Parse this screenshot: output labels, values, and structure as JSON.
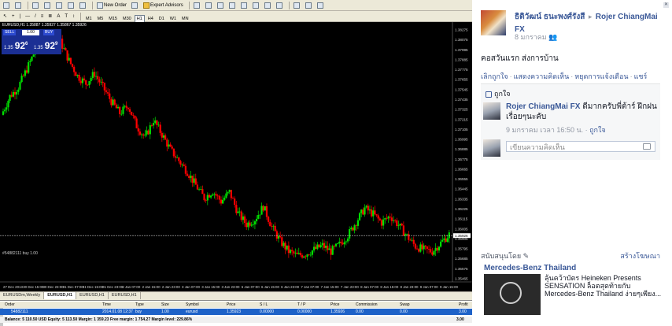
{
  "toolbar": {
    "new_order": "New Order",
    "expert_advisors": "Expert Advisors",
    "timeframes": [
      "M1",
      "M5",
      "M15",
      "M30",
      "H1",
      "H4",
      "D1",
      "W1",
      "MN"
    ],
    "active_timeframe": "H1"
  },
  "chart": {
    "title": "EURUSD,H1  1.35887 1.35927 1.35867 1.35926",
    "order_line_label": "#54882111 buy 1.00"
  },
  "trade_panel": {
    "sell_label": "SELL",
    "buy_label": "BUY",
    "lot": "1.00",
    "bid_prefix": "1.35",
    "bid_big": "92",
    "bid_sup": "6",
    "ask_prefix": "1.35",
    "ask_big": "92",
    "ask_sup": "9"
  },
  "chart_data": {
    "type": "candlestick",
    "symbol": "EURUSD",
    "timeframe": "H1",
    "y_ticks": [
      "1.38275",
      "1.38075",
      "1.37995",
      "1.37885",
      "1.37775",
      "1.37655",
      "1.37545",
      "1.37435",
      "1.37325",
      "1.37215",
      "1.37105",
      "1.36995",
      "1.36885",
      "1.36775",
      "1.36665",
      "1.36555",
      "1.36445",
      "1.36335",
      "1.36225",
      "1.36115",
      "1.36005",
      "1.35905",
      "1.35795",
      "1.35685",
      "1.35575",
      "1.35465"
    ],
    "current_price": "1.35926",
    "x_ticks": [
      "27 Dec 2013",
      "30 Dec 15:00",
      "30 Dec 23:00",
      "31 Dec 07:00",
      "31 Dec 15:00",
      "31 Dec 23:00",
      "2 Jan 07:00",
      "2 Jan 15:00",
      "2 Jan 23:00",
      "3 Jan 07:00",
      "3 Jan 15:00",
      "3 Jan 23:00",
      "6 Jan 07:00",
      "6 Jan 15:00",
      "6 Jan 23:00",
      "7 Jan 07:00",
      "7 Jan 15:00",
      "7 Jan 23:00",
      "8 Jan 07:00",
      "8 Jan 15:00",
      "8 Jan 23:00",
      "9 Jan 07:00",
      "9 Jan 15:00"
    ],
    "ylim": [
      1.3538,
      1.3839
    ],
    "close_path": [
      1.3735,
      1.3757,
      1.3768,
      1.3789,
      1.3811,
      1.3822,
      1.3828,
      1.3821,
      1.3799,
      1.3781,
      1.3772,
      1.3784,
      1.3768,
      1.3751,
      1.3737,
      1.3746,
      1.3722,
      1.3708,
      1.3729,
      1.3712,
      1.3694,
      1.3681,
      1.3668,
      1.3652,
      1.3637,
      1.3645,
      1.3633,
      1.3644,
      1.3619,
      1.3606,
      1.3612,
      1.3627,
      1.3603,
      1.3586,
      1.3574,
      1.3569,
      1.3571,
      1.3576,
      1.3581,
      1.3574,
      1.3582,
      1.3593,
      1.3609,
      1.3625,
      1.3618,
      1.3608,
      1.3616,
      1.3605,
      1.3592,
      1.358,
      1.3576,
      1.3574,
      1.3584,
      1.3594
    ]
  },
  "chart_tabs": [
    "EURUSDm,Weekly",
    "EURUSD,H1",
    "EURUSD,H1",
    "EURUSD,H1"
  ],
  "active_chart_tab": 1,
  "terminal": {
    "headers": [
      "Order",
      "Time",
      "Type",
      "Size",
      "Symbol",
      "Price",
      "S / L",
      "T / P",
      "Price",
      "Commission",
      "Swap",
      "Profit"
    ],
    "rows": [
      [
        "54882111",
        "2014.01.08 12:37",
        "buy",
        "1.00",
        "eurusd",
        "1.35923",
        "0.00000",
        "0.00000",
        "1.35926",
        "0.00",
        "0.00",
        "3.00"
      ]
    ],
    "balance_text": "Balance: 5 110.50 USD  Equity: 5 113.50  Margin: 1 359.23  Free margin: 1 754.27  Margin level: 229.86%",
    "balance_profit": "3.00"
  },
  "facebook": {
    "author": "ธิติวัฒน์ ธนะพงศ์รังสี",
    "arrow": "▸",
    "target": "Rojer ChiangMai FX",
    "time": "8 มกราคม",
    "post_text": "คอสวันแรก ส่งการบ้าน",
    "actions": [
      "เลิกถูกใจ",
      "แสดงความคิดเห็น",
      "หยุดการแจ้งเตือน",
      "แชร์"
    ],
    "likes_text": "ถูกใจ",
    "comment": {
      "author": "Rojer ChiangMai FX",
      "text": "ดีมากครับพี่ต้าร์ ฝึกฝนเรื่อยๆนะคับ",
      "time": "9 มกราคม เวลา 16:50 น.",
      "like_link": "ถูกใจ"
    },
    "comment_placeholder": "เขียนความคิดเห็น",
    "ads": {
      "title": "สนับสนุนโดย",
      "create": "สร้างโฆษณา",
      "ad_title": "Mercedes-Benz Thailand",
      "ad_body": "ลุ้นคว้าบัตร Heineken Presents SENSATION ล็อตสุดท้ายกับ Mercedes-Benz Thailand ง่ายๆเพียง..."
    }
  }
}
